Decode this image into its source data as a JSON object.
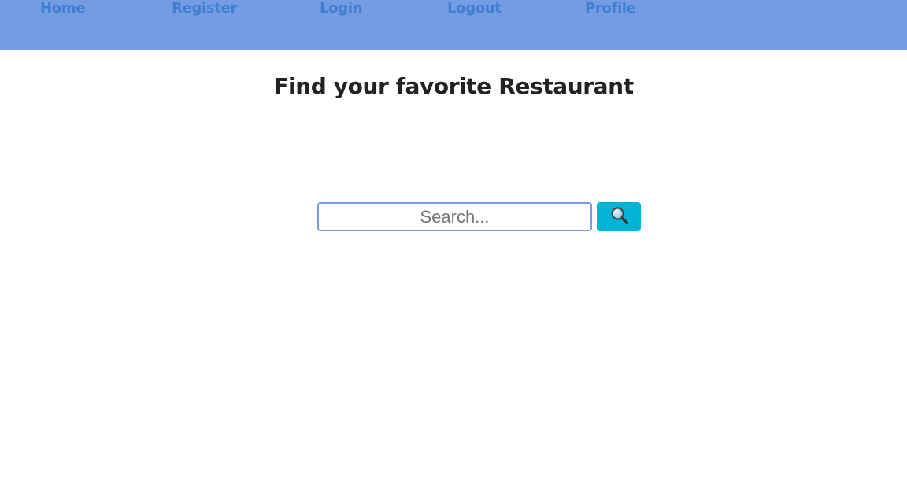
{
  "nav": {
    "items": [
      {
        "label": "Home"
      },
      {
        "label": "Register"
      },
      {
        "label": "Login"
      },
      {
        "label": "Logout"
      },
      {
        "label": "Profile"
      }
    ]
  },
  "main": {
    "title": "Find your favorite Restaurant"
  },
  "search": {
    "placeholder": "Search...",
    "value": "",
    "button_icon": "magnifying-glass-icon"
  },
  "colors": {
    "navbar_bg": "#759ce2",
    "nav_link": "#3d7fd0",
    "title_text": "#222222",
    "input_border": "#759ce2",
    "search_button_bg": "#00b4d6"
  }
}
